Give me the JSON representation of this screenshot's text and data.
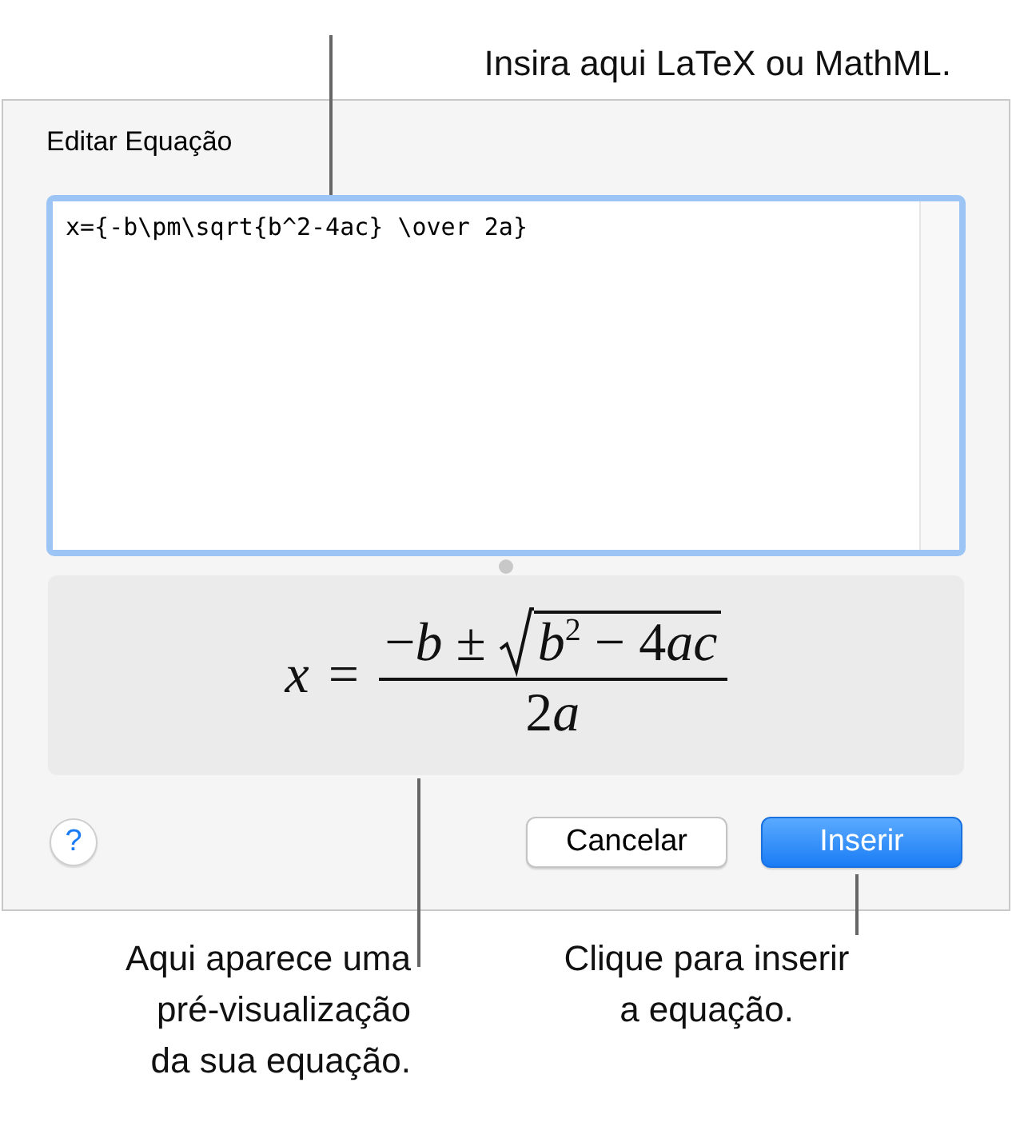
{
  "callouts": {
    "top": "Insira aqui LaTeX ou MathML.",
    "preview": "Aqui aparece uma pré-visualização da sua equação.",
    "insert": "Clique para inserir a equação."
  },
  "dialog": {
    "title": "Editar Equação",
    "source": "x={-b\\pm\\sqrt{b^2-4ac} \\over 2a}",
    "preview": {
      "lhs": "x",
      "relation": "=",
      "numerator": [
        {
          "text": "−",
          "kind": "upright"
        },
        {
          "text": "b",
          "kind": "italic"
        },
        {
          "text": " ± ",
          "kind": "upright"
        }
      ],
      "radicand": [
        {
          "text": "b",
          "kind": "italic"
        },
        {
          "text": "2",
          "kind": "sup"
        },
        {
          "text": " − 4",
          "kind": "upright"
        },
        {
          "text": "ac",
          "kind": "italic"
        }
      ],
      "denominator": [
        {
          "text": "2",
          "kind": "upright"
        },
        {
          "text": "a",
          "kind": "italic"
        }
      ]
    },
    "help": "?",
    "buttons": [
      {
        "label": "Cancelar",
        "kind": "secondary"
      },
      {
        "label": "Inserir",
        "kind": "primary"
      }
    ]
  }
}
